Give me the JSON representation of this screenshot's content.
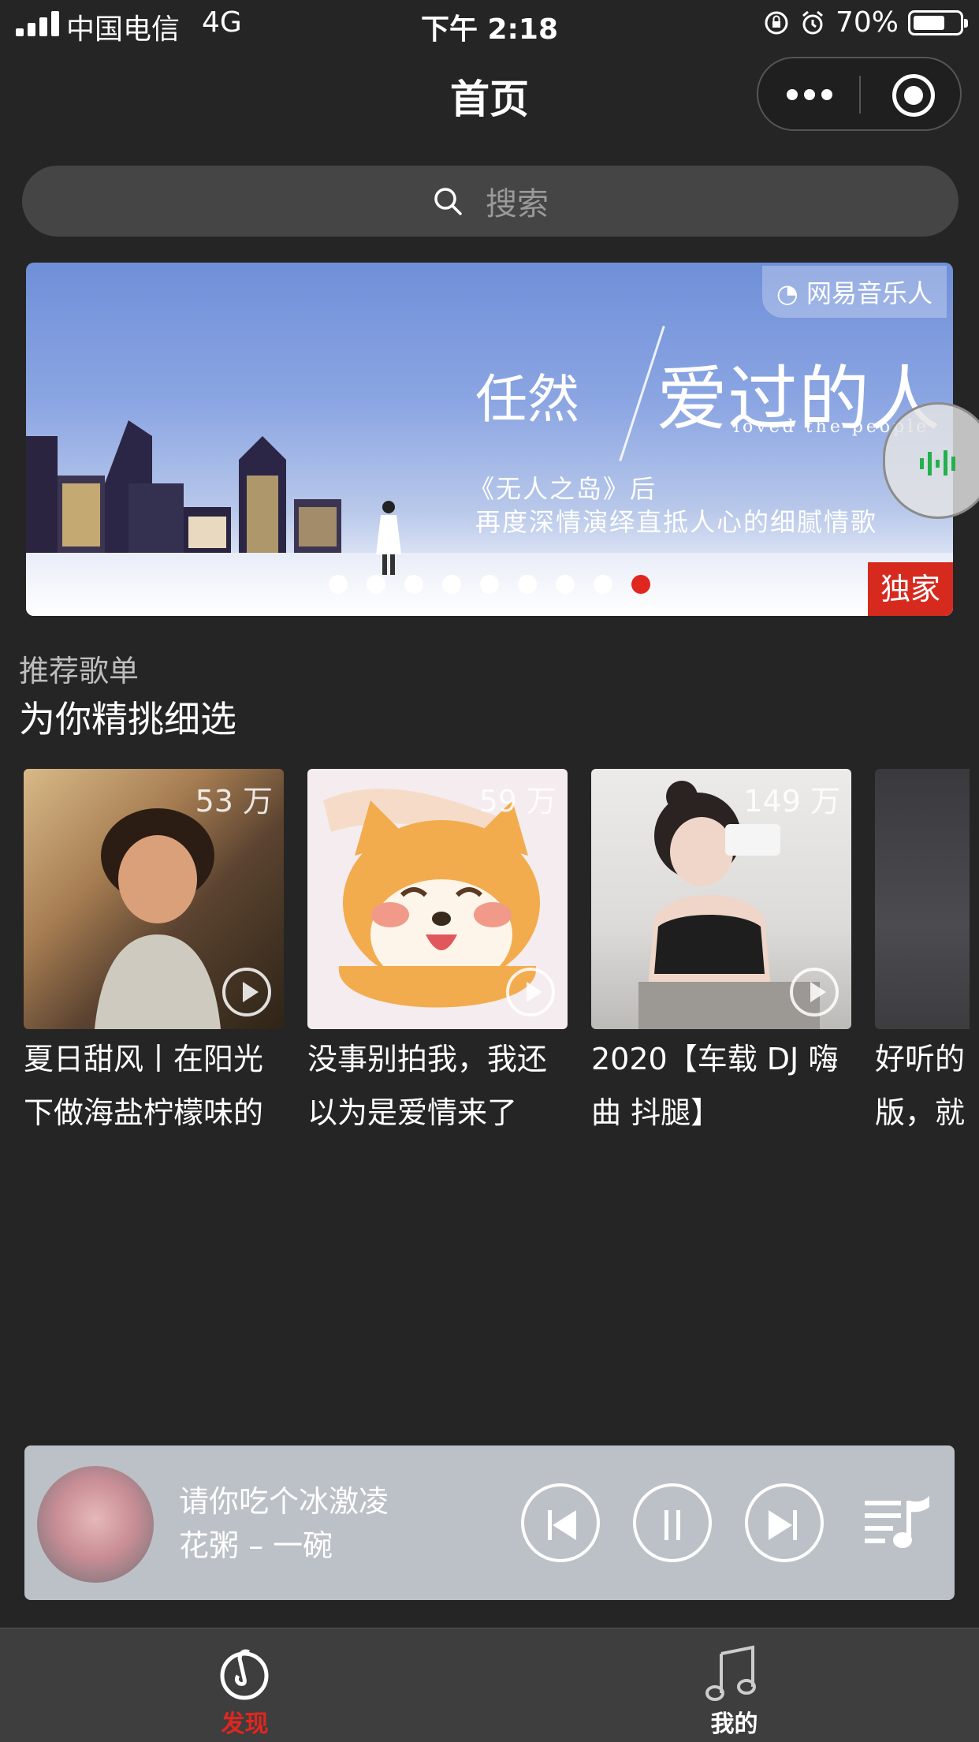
{
  "status_bar": {
    "carrier": "中国电信",
    "network": "4G",
    "time": "下午 2:18",
    "battery": "70%",
    "battery_level": 0.7
  },
  "nav": {
    "title": "首页"
  },
  "search": {
    "placeholder": "搜索"
  },
  "banner": {
    "brand": "网易音乐人",
    "artist": "任然",
    "song_title": "爱过的人",
    "song_title_en": "loved the people",
    "line1": "《无人之岛》后",
    "line2": "再度深情演绎直抵人心的细腻情歌",
    "badge": "独家",
    "dot_count": 9,
    "active_dot": 8
  },
  "playlists": {
    "subtitle": "推荐歌单",
    "title": "为你精挑细选",
    "items": [
      {
        "count": "53 万",
        "name": "夏日甜风丨在阳光下做海盐柠檬味的"
      },
      {
        "count": "59 万",
        "name": "没事别拍我，我还以为是爱情来了"
      },
      {
        "count": "149 万",
        "name": "2020【车载 DJ 嗨曲 抖腿】"
      },
      {
        "count": "",
        "name": "好听的版，就"
      }
    ]
  },
  "player": {
    "song": "请你吃个冰激凌",
    "artist": "花粥 – 一碗"
  },
  "tabbar": {
    "tabs": [
      {
        "label": "发现",
        "active": true
      },
      {
        "label": "我的",
        "active": false
      }
    ]
  },
  "colors": {
    "accent": "#e0261f",
    "background": "#252525",
    "player_bg": "#bcc1c7",
    "tabbar_bg": "#3e3e3e"
  }
}
